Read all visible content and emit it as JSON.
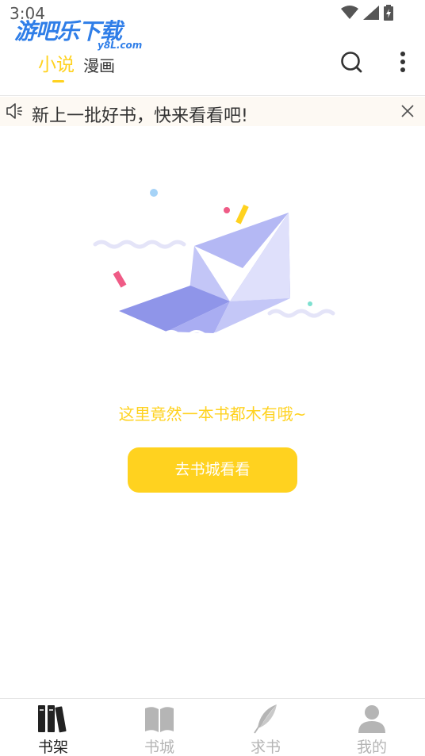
{
  "status_bar": {
    "time": "3:04"
  },
  "watermark": {
    "main": "游吧乐下载",
    "sub": "y8L.com"
  },
  "header": {
    "tabs": [
      {
        "label": "小说",
        "active": true
      },
      {
        "label": "漫画",
        "active": false
      }
    ],
    "icons": [
      "search-icon",
      "more-vert-icon"
    ]
  },
  "notice": {
    "text": "新上一批好书，快来看看吧!",
    "icon": "speaker-icon",
    "close_icon": "close-icon"
  },
  "empty_state": {
    "illustration": "paper-boat",
    "message": "这里竟然一本书都木有哦~",
    "button_label": "去书城看看"
  },
  "bottom_nav": {
    "items": [
      {
        "label": "书架",
        "icon": "bookshelf-icon",
        "active": true
      },
      {
        "label": "书城",
        "icon": "open-book-icon",
        "active": false
      },
      {
        "label": "求书",
        "icon": "feather-icon",
        "active": false
      },
      {
        "label": "我的",
        "icon": "user-icon",
        "active": false
      }
    ]
  },
  "colors": {
    "accent": "#ffd21f",
    "notice_bg": "#fdf9f3",
    "inactive": "#b5b5b5",
    "boat": "#a8acf0"
  }
}
